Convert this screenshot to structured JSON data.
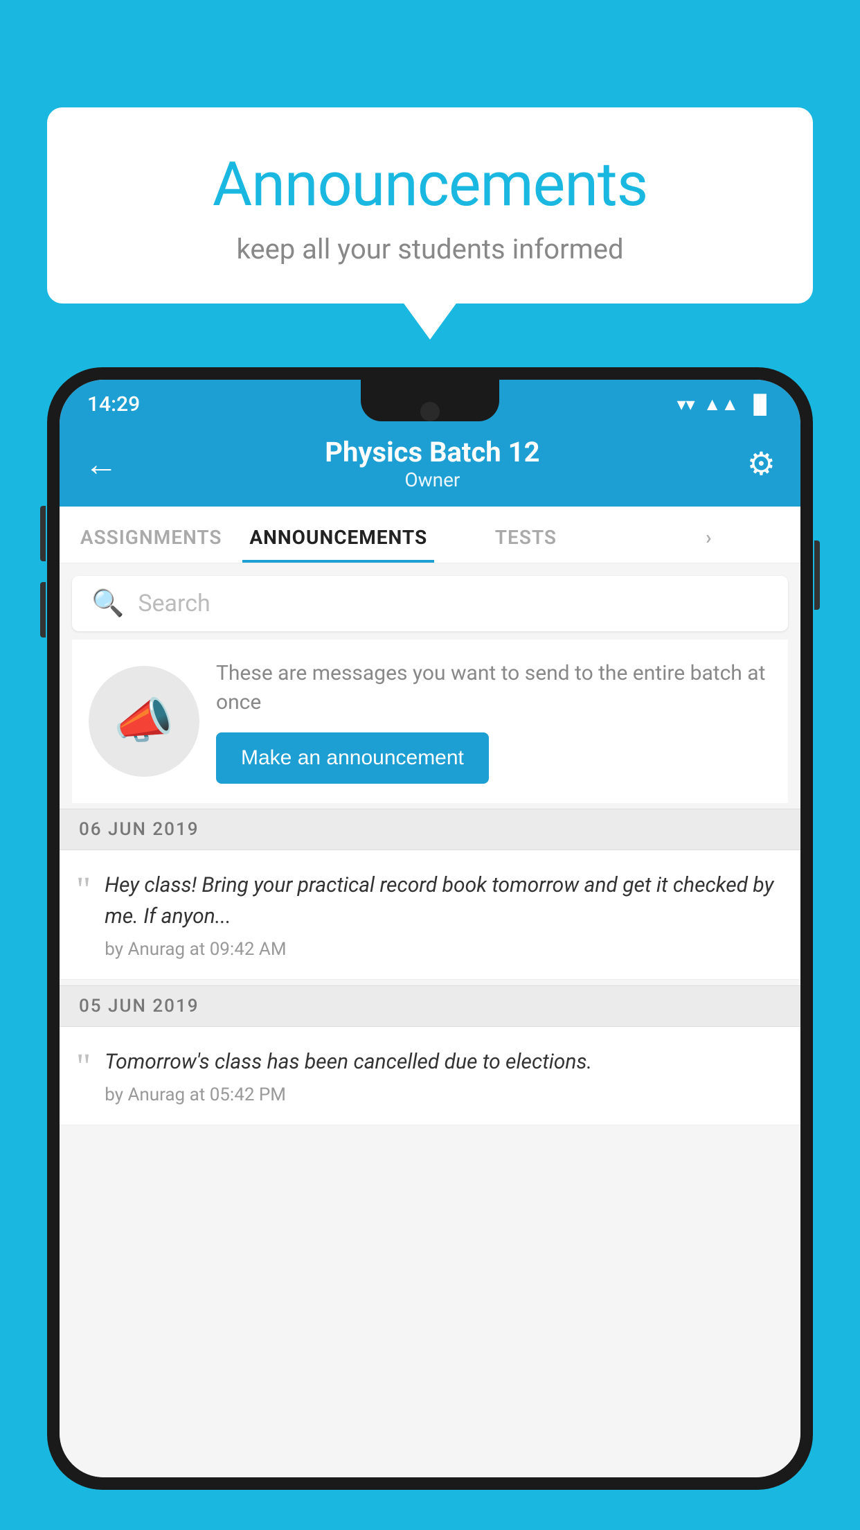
{
  "bubble": {
    "title": "Announcements",
    "subtitle": "keep all your students informed"
  },
  "statusBar": {
    "time": "14:29",
    "wifi": "▲",
    "signal": "▲",
    "battery": "▐"
  },
  "header": {
    "title": "Physics Batch 12",
    "subtitle": "Owner",
    "backLabel": "←",
    "gearLabel": "⚙"
  },
  "tabs": [
    {
      "label": "ASSIGNMENTS",
      "active": false
    },
    {
      "label": "ANNOUNCEMENTS",
      "active": true
    },
    {
      "label": "TESTS",
      "active": false
    },
    {
      "label": "·",
      "active": false
    }
  ],
  "search": {
    "placeholder": "Search"
  },
  "promo": {
    "description": "These are messages you want to send to the entire batch at once",
    "buttonLabel": "Make an announcement"
  },
  "dates": [
    {
      "label": "06  JUN  2019",
      "items": [
        {
          "text": "Hey class! Bring your practical record book tomorrow and get it checked by me. If anyon...",
          "meta": "by Anurag at 09:42 AM"
        }
      ]
    },
    {
      "label": "05  JUN  2019",
      "items": [
        {
          "text": "Tomorrow's class has been cancelled due to elections.",
          "meta": "by Anurag at 05:42 PM"
        }
      ]
    }
  ]
}
